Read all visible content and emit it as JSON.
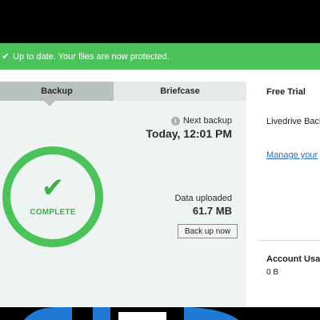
{
  "status": {
    "icon": "check-icon",
    "message": "Up to date. Your files are now protected."
  },
  "tabs": [
    {
      "label": "Backup",
      "active": true
    },
    {
      "label": "Briefcase",
      "active": false
    }
  ],
  "progress": {
    "state_label": "COMPLETE",
    "percent": 100,
    "color": "#4cc25a"
  },
  "next_backup": {
    "label": "Next backup",
    "value": "Today, 12:01 PM",
    "icon": "info-icon"
  },
  "data_uploaded": {
    "label": "Data uploaded",
    "value": "61.7 MB"
  },
  "actions": {
    "backup_now": "Back up now"
  },
  "sidebar": {
    "plan_title": "Free Trial",
    "plan_name": "Livedrive Back",
    "manage_link": "Manage your",
    "usage_title": "Account Usag",
    "usage_value": "0 B"
  },
  "colors": {
    "accent_green": "#4cc25a",
    "link_blue": "#2a6fb5",
    "panel_bg": "#eef4f2"
  }
}
